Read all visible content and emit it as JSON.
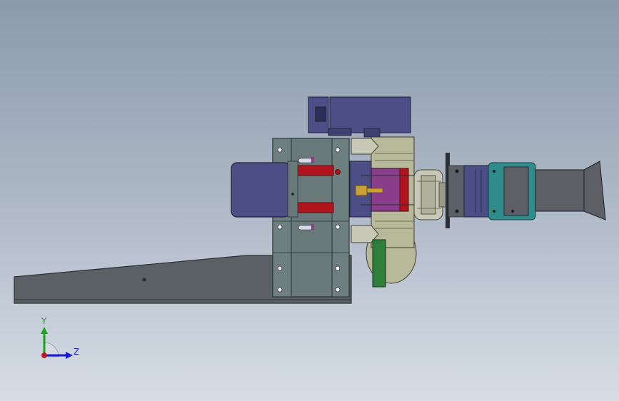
{
  "viewport": {
    "background_top": "#8c9aab",
    "background_bottom": "#d6dde6"
  },
  "triad": {
    "y_label": "Y",
    "z_label": "Z",
    "y_color": "#1aa51a",
    "z_color": "#1a1ad6",
    "x_color": "#c01818"
  },
  "colors": {
    "base_plate": "#5b6066",
    "frame": "#69797a",
    "motor": "#4b4f86",
    "rod": "#b0141c",
    "fan_housing": "#b8b89a",
    "slide_body": "#8a3d8a",
    "bracket_green": "#2f7f3a",
    "teal_clamp": "#2f8c8a",
    "nozzle": "#5c5f66"
  }
}
